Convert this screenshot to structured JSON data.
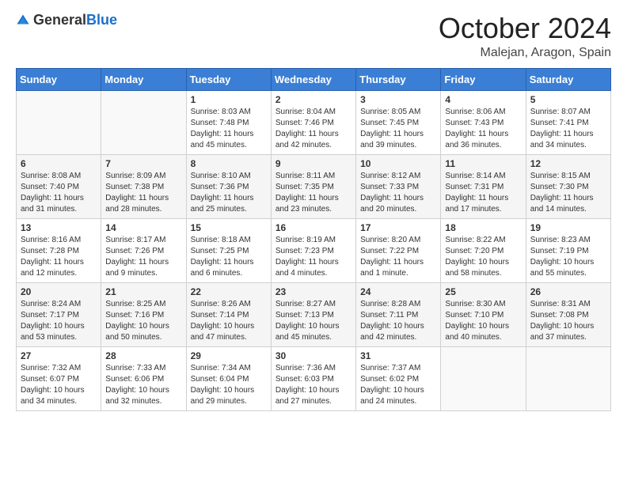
{
  "logo": {
    "text_general": "General",
    "text_blue": "Blue"
  },
  "title": {
    "month_year": "October 2024",
    "location": "Malejan, Aragon, Spain"
  },
  "days_of_week": [
    "Sunday",
    "Monday",
    "Tuesday",
    "Wednesday",
    "Thursday",
    "Friday",
    "Saturday"
  ],
  "weeks": [
    [
      {
        "day": "",
        "sunrise": "",
        "sunset": "",
        "daylight": ""
      },
      {
        "day": "",
        "sunrise": "",
        "sunset": "",
        "daylight": ""
      },
      {
        "day": "1",
        "sunrise": "Sunrise: 8:03 AM",
        "sunset": "Sunset: 7:48 PM",
        "daylight": "Daylight: 11 hours and 45 minutes."
      },
      {
        "day": "2",
        "sunrise": "Sunrise: 8:04 AM",
        "sunset": "Sunset: 7:46 PM",
        "daylight": "Daylight: 11 hours and 42 minutes."
      },
      {
        "day": "3",
        "sunrise": "Sunrise: 8:05 AM",
        "sunset": "Sunset: 7:45 PM",
        "daylight": "Daylight: 11 hours and 39 minutes."
      },
      {
        "day": "4",
        "sunrise": "Sunrise: 8:06 AM",
        "sunset": "Sunset: 7:43 PM",
        "daylight": "Daylight: 11 hours and 36 minutes."
      },
      {
        "day": "5",
        "sunrise": "Sunrise: 8:07 AM",
        "sunset": "Sunset: 7:41 PM",
        "daylight": "Daylight: 11 hours and 34 minutes."
      }
    ],
    [
      {
        "day": "6",
        "sunrise": "Sunrise: 8:08 AM",
        "sunset": "Sunset: 7:40 PM",
        "daylight": "Daylight: 11 hours and 31 minutes."
      },
      {
        "day": "7",
        "sunrise": "Sunrise: 8:09 AM",
        "sunset": "Sunset: 7:38 PM",
        "daylight": "Daylight: 11 hours and 28 minutes."
      },
      {
        "day": "8",
        "sunrise": "Sunrise: 8:10 AM",
        "sunset": "Sunset: 7:36 PM",
        "daylight": "Daylight: 11 hours and 25 minutes."
      },
      {
        "day": "9",
        "sunrise": "Sunrise: 8:11 AM",
        "sunset": "Sunset: 7:35 PM",
        "daylight": "Daylight: 11 hours and 23 minutes."
      },
      {
        "day": "10",
        "sunrise": "Sunrise: 8:12 AM",
        "sunset": "Sunset: 7:33 PM",
        "daylight": "Daylight: 11 hours and 20 minutes."
      },
      {
        "day": "11",
        "sunrise": "Sunrise: 8:14 AM",
        "sunset": "Sunset: 7:31 PM",
        "daylight": "Daylight: 11 hours and 17 minutes."
      },
      {
        "day": "12",
        "sunrise": "Sunrise: 8:15 AM",
        "sunset": "Sunset: 7:30 PM",
        "daylight": "Daylight: 11 hours and 14 minutes."
      }
    ],
    [
      {
        "day": "13",
        "sunrise": "Sunrise: 8:16 AM",
        "sunset": "Sunset: 7:28 PM",
        "daylight": "Daylight: 11 hours and 12 minutes."
      },
      {
        "day": "14",
        "sunrise": "Sunrise: 8:17 AM",
        "sunset": "Sunset: 7:26 PM",
        "daylight": "Daylight: 11 hours and 9 minutes."
      },
      {
        "day": "15",
        "sunrise": "Sunrise: 8:18 AM",
        "sunset": "Sunset: 7:25 PM",
        "daylight": "Daylight: 11 hours and 6 minutes."
      },
      {
        "day": "16",
        "sunrise": "Sunrise: 8:19 AM",
        "sunset": "Sunset: 7:23 PM",
        "daylight": "Daylight: 11 hours and 4 minutes."
      },
      {
        "day": "17",
        "sunrise": "Sunrise: 8:20 AM",
        "sunset": "Sunset: 7:22 PM",
        "daylight": "Daylight: 11 hours and 1 minute."
      },
      {
        "day": "18",
        "sunrise": "Sunrise: 8:22 AM",
        "sunset": "Sunset: 7:20 PM",
        "daylight": "Daylight: 10 hours and 58 minutes."
      },
      {
        "day": "19",
        "sunrise": "Sunrise: 8:23 AM",
        "sunset": "Sunset: 7:19 PM",
        "daylight": "Daylight: 10 hours and 55 minutes."
      }
    ],
    [
      {
        "day": "20",
        "sunrise": "Sunrise: 8:24 AM",
        "sunset": "Sunset: 7:17 PM",
        "daylight": "Daylight: 10 hours and 53 minutes."
      },
      {
        "day": "21",
        "sunrise": "Sunrise: 8:25 AM",
        "sunset": "Sunset: 7:16 PM",
        "daylight": "Daylight: 10 hours and 50 minutes."
      },
      {
        "day": "22",
        "sunrise": "Sunrise: 8:26 AM",
        "sunset": "Sunset: 7:14 PM",
        "daylight": "Daylight: 10 hours and 47 minutes."
      },
      {
        "day": "23",
        "sunrise": "Sunrise: 8:27 AM",
        "sunset": "Sunset: 7:13 PM",
        "daylight": "Daylight: 10 hours and 45 minutes."
      },
      {
        "day": "24",
        "sunrise": "Sunrise: 8:28 AM",
        "sunset": "Sunset: 7:11 PM",
        "daylight": "Daylight: 10 hours and 42 minutes."
      },
      {
        "day": "25",
        "sunrise": "Sunrise: 8:30 AM",
        "sunset": "Sunset: 7:10 PM",
        "daylight": "Daylight: 10 hours and 40 minutes."
      },
      {
        "day": "26",
        "sunrise": "Sunrise: 8:31 AM",
        "sunset": "Sunset: 7:08 PM",
        "daylight": "Daylight: 10 hours and 37 minutes."
      }
    ],
    [
      {
        "day": "27",
        "sunrise": "Sunrise: 7:32 AM",
        "sunset": "Sunset: 6:07 PM",
        "daylight": "Daylight: 10 hours and 34 minutes."
      },
      {
        "day": "28",
        "sunrise": "Sunrise: 7:33 AM",
        "sunset": "Sunset: 6:06 PM",
        "daylight": "Daylight: 10 hours and 32 minutes."
      },
      {
        "day": "29",
        "sunrise": "Sunrise: 7:34 AM",
        "sunset": "Sunset: 6:04 PM",
        "daylight": "Daylight: 10 hours and 29 minutes."
      },
      {
        "day": "30",
        "sunrise": "Sunrise: 7:36 AM",
        "sunset": "Sunset: 6:03 PM",
        "daylight": "Daylight: 10 hours and 27 minutes."
      },
      {
        "day": "31",
        "sunrise": "Sunrise: 7:37 AM",
        "sunset": "Sunset: 6:02 PM",
        "daylight": "Daylight: 10 hours and 24 minutes."
      },
      {
        "day": "",
        "sunrise": "",
        "sunset": "",
        "daylight": ""
      },
      {
        "day": "",
        "sunrise": "",
        "sunset": "",
        "daylight": ""
      }
    ]
  ]
}
